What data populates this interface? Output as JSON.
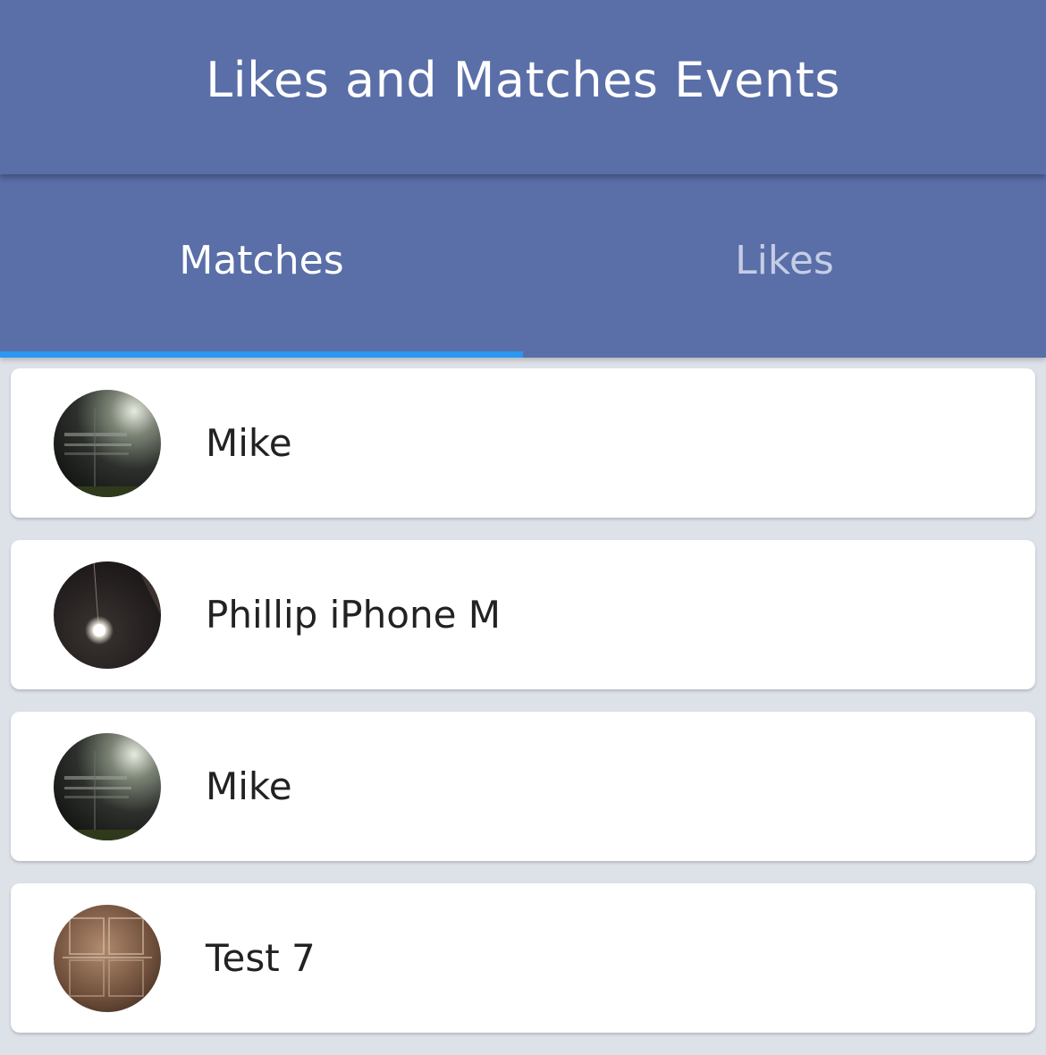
{
  "header": {
    "title": "Likes and Matches Events"
  },
  "tabs": [
    {
      "label": "Matches",
      "active": true
    },
    {
      "label": "Likes",
      "active": false
    }
  ],
  "matches": [
    {
      "name": "Mike",
      "avatar": "dark-door-photo"
    },
    {
      "name": "Phillip iPhone M",
      "avatar": "ceiling-light-photo"
    },
    {
      "name": "Mike",
      "avatar": "dark-door-photo"
    },
    {
      "name": "Test 7",
      "avatar": "brown-door-photo"
    }
  ],
  "colors": {
    "header_bg": "#5a6ea8",
    "tab_indicator": "#2b97f0",
    "page_bg": "#dde1e8"
  }
}
